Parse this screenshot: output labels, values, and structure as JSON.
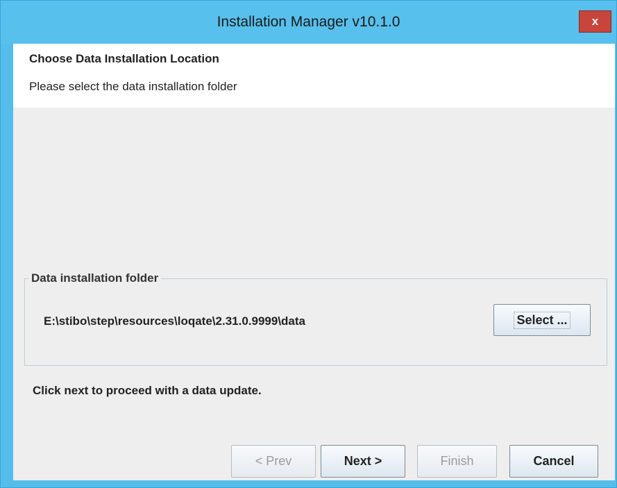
{
  "window": {
    "title": "Installation Manager v10.1.0",
    "close_glyph": "x"
  },
  "header": {
    "title": "Choose Data Installation Location",
    "subtitle": "Please select the data installation folder"
  },
  "folder_group": {
    "legend": "Data installation folder",
    "path": "E:\\stibo\\step\\resources\\loqate\\2.31.0.9999\\data",
    "select_label": "Select ..."
  },
  "info": "Click next to proceed with a data update.",
  "footer": {
    "prev_label": "< Prev",
    "next_label": "Next >",
    "finish_label": "Finish",
    "cancel_label": "Cancel"
  },
  "colors": {
    "titlebar": "#58c0ec",
    "close_button": "#c7453b",
    "client_background": "#eeeeee"
  }
}
